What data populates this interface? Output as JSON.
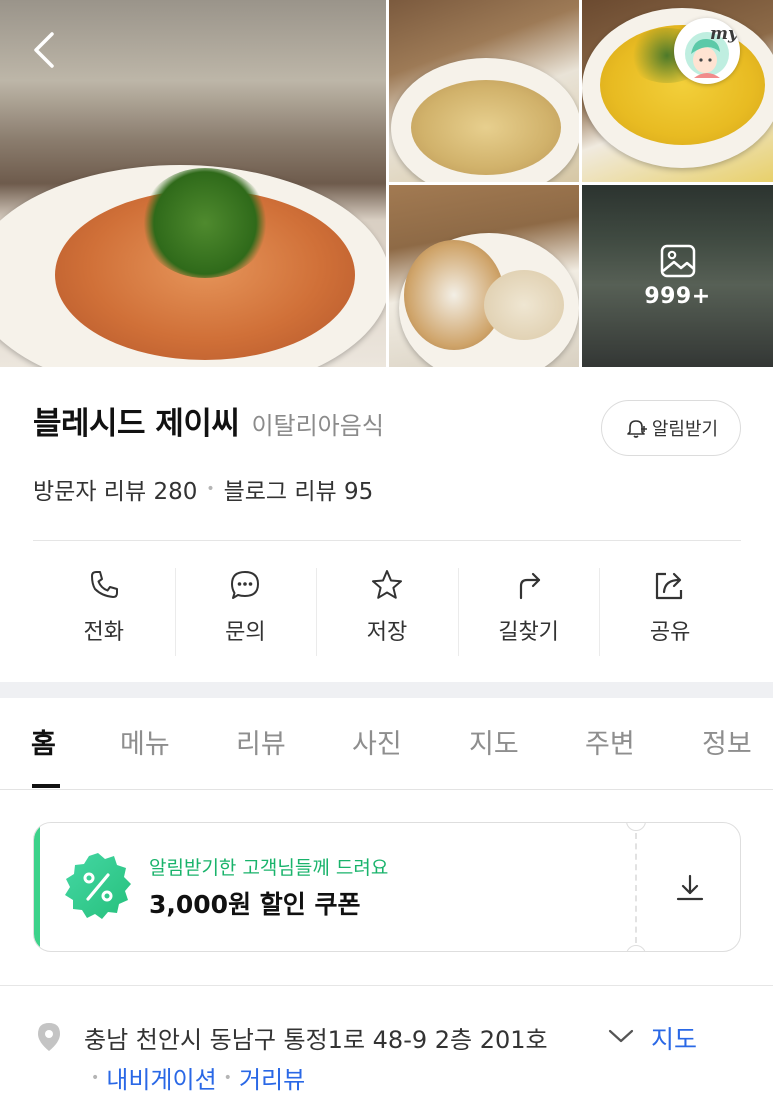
{
  "gallery": {
    "photo_count": "999+",
    "my_badge": "my"
  },
  "place": {
    "name": "블레시드 제이씨",
    "category": "이탈리아음식",
    "notify_label": "알림받기",
    "visitor_reviews_label": "방문자 리뷰",
    "visitor_reviews_count": "280",
    "blog_reviews_label": "블로그 리뷰",
    "blog_reviews_count": "95"
  },
  "actions": [
    {
      "label": "전화",
      "icon": "phone-icon"
    },
    {
      "label": "문의",
      "icon": "chat-icon"
    },
    {
      "label": "저장",
      "icon": "star-icon"
    },
    {
      "label": "길찾기",
      "icon": "directions-icon"
    },
    {
      "label": "공유",
      "icon": "share-icon"
    }
  ],
  "tabs": [
    {
      "label": "홈",
      "active": true
    },
    {
      "label": "메뉴"
    },
    {
      "label": "리뷰"
    },
    {
      "label": "사진"
    },
    {
      "label": "지도"
    },
    {
      "label": "주변"
    },
    {
      "label": "정보"
    }
  ],
  "coupon": {
    "subtitle": "알림받기한 고객님들께 드려요",
    "title": "3,000원 할인 쿠폰",
    "accent_color": "#3cd28a"
  },
  "address": {
    "text": "충남 천안시 동남구 통정1로 48-9 2층 201호",
    "map_link": "지도",
    "navigation_link": "내비게이션",
    "street_view_link": "거리뷰",
    "link_color": "#2a68e6"
  }
}
